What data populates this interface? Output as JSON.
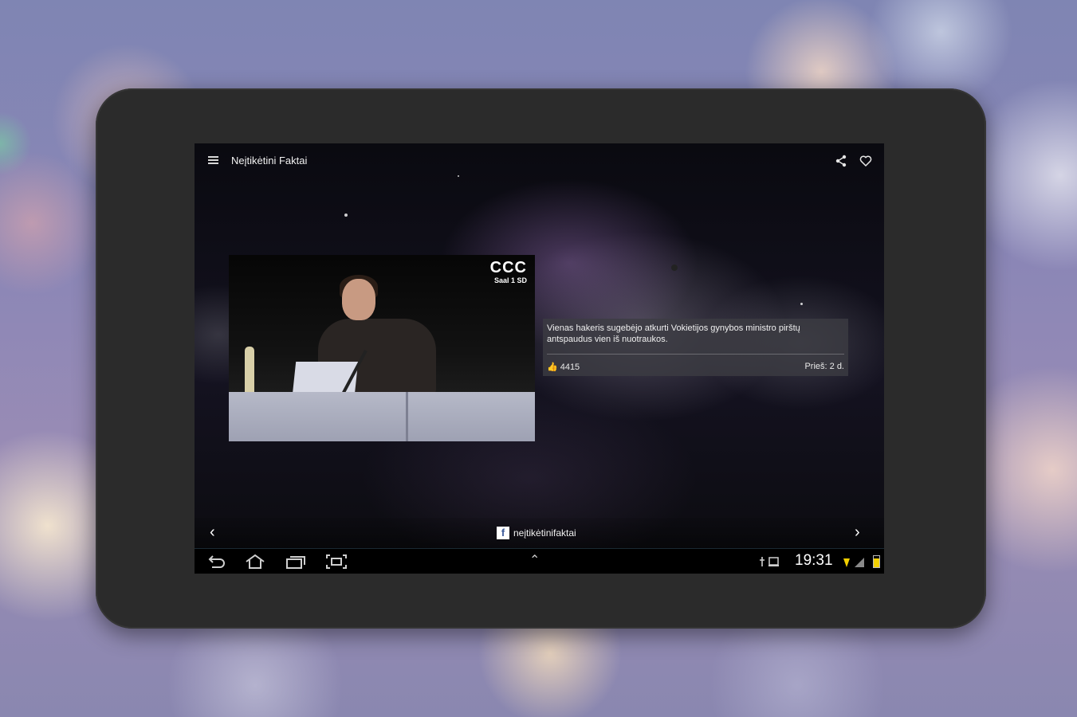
{
  "app": {
    "title": "Neįtikėtini Faktai"
  },
  "topbar": {
    "menu_icon": "hamburger-menu-icon",
    "share_icon": "share-icon",
    "favorite_icon": "heart-icon"
  },
  "post": {
    "thumbnail_logo": "CCC",
    "thumbnail_logo_sub": "Saal 1 SD",
    "headline": "Vienas hakeris sugebėjo atkurti Vokietijos gynybos ministro pirštų antspaudus vien iš nuotraukos.",
    "likes": "4415",
    "posted": "Prieš: 2 d."
  },
  "pager": {
    "prev_icon": "chevron-left-icon",
    "next_icon": "chevron-right-icon",
    "source_icon": "f",
    "page_name": "neįtikėtinifaktai"
  },
  "system_bar": {
    "clock": "19:31",
    "buttons": [
      "back-icon",
      "home-icon",
      "recent-apps-icon",
      "screenshot-icon"
    ],
    "accent_battery": "#f2d000"
  }
}
